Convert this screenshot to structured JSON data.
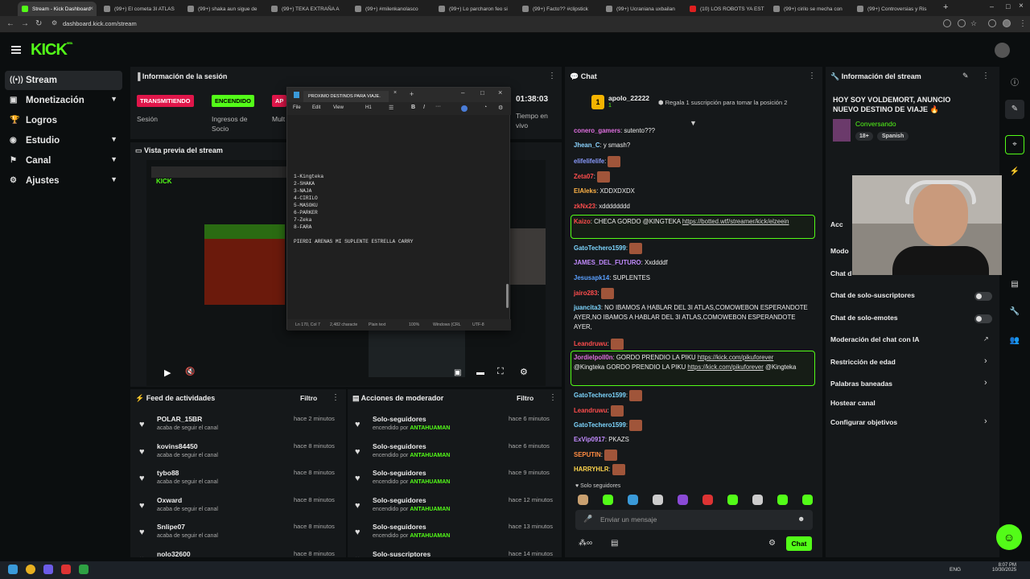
{
  "browser": {
    "tabs": [
      {
        "label": "Stream - Kick Dashboard",
        "active": true
      },
      {
        "label": "(99+) El cometa 3I ATLAS"
      },
      {
        "label": "(99+) shaka aun sigue de"
      },
      {
        "label": "(99+) TEKA EXTRAÑA A"
      },
      {
        "label": "(99+) #milenkanolasco"
      },
      {
        "label": "(99+) Lo parcharon feo si"
      },
      {
        "label": "(99+) Facto?? #clipstick"
      },
      {
        "label": "(99+) Ucraniana uxbailan"
      },
      {
        "label": "(10) LOS ROBOTS YA EST"
      },
      {
        "label": "(99+) cirilo se mecha con"
      },
      {
        "label": "(99+) Controversias y Ris"
      }
    ],
    "url": "dashboard.kick.com/stream"
  },
  "brand": {
    "logo": "KICK",
    "beta": "BETA",
    "accent": "#53fc18"
  },
  "sidebar": {
    "items": [
      {
        "label": "Stream",
        "icon": "broadcast-icon"
      },
      {
        "label": "Monetización",
        "icon": "wallet-icon"
      },
      {
        "label": "Logros",
        "icon": "trophy-icon"
      },
      {
        "label": "Estudio",
        "icon": "studio-icon"
      },
      {
        "label": "Canal",
        "icon": "flag-icon"
      },
      {
        "label": "Ajustes",
        "icon": "gear-icon"
      }
    ]
  },
  "session": {
    "title": "Información de la sesión",
    "badge_live": "TRANSMITIENDO",
    "badge_on": "ENCENDIDO",
    "badge_partial": "AP",
    "label_session": "Sesión",
    "label_income": "Ingresos de Socio",
    "label_multi": "Mult",
    "time": "01:38:03",
    "time_label": "Tiempo en vivo"
  },
  "preview": {
    "title": "Vista previa del stream"
  },
  "editor": {
    "title": "PROXIMO DESTINOS PARA VIAJE.",
    "menu": [
      "File",
      "Edit",
      "View",
      "H1"
    ],
    "lines": "1-Kingteka\n2-SHAKA\n3-NAJA\n4-CIRILO\n5-MASOKU\n6-PARKER\n7-Zeka\n8-FARA\n\nPIERDI ARENAS MI SUPLENTE ESTRELLA CARRY",
    "status": [
      "Ln 170, Col 7",
      "2,482 characte",
      "Plain text",
      "100%",
      "Windows (CRL",
      "UTF-8"
    ]
  },
  "activity": {
    "title": "Feed de actividades",
    "filter": "Filtro",
    "items": [
      {
        "name": "POLAR_15BR",
        "sub": "acaba de seguir el canal",
        "time": "hace 2 minutos"
      },
      {
        "name": "kovins84450",
        "sub": "acaba de seguir el canal",
        "time": "hace 8 minutos"
      },
      {
        "name": "tybo88",
        "sub": "acaba de seguir el canal",
        "time": "hace 8 minutos"
      },
      {
        "name": "Oxward",
        "sub": "acaba de seguir el canal",
        "time": "hace 8 minutos"
      },
      {
        "name": "Snlipe07",
        "sub": "acaba de seguir el canal",
        "time": "hace 8 minutos"
      },
      {
        "name": "nolo32600",
        "sub": "",
        "time": "hace 8 minutos"
      }
    ]
  },
  "moderator": {
    "title": "Acciones de moderador",
    "filter": "Filtro",
    "items": [
      {
        "name": "Solo-seguidores",
        "sub": "encendido por",
        "by": "ANTAHUAMAN",
        "time": "hace 6 minutos"
      },
      {
        "name": "Solo-seguidores",
        "sub": "encendido por",
        "by": "ANTAHUAMAN",
        "time": "hace 6 minutos"
      },
      {
        "name": "Solo-seguidores",
        "sub": "encendido por",
        "by": "ANTAHUAMAN",
        "time": "hace 9 minutos"
      },
      {
        "name": "Solo-seguidores",
        "sub": "encendido por",
        "by": "ANTAHUAMAN",
        "time": "hace 12 minutos"
      },
      {
        "name": "Solo-seguidores",
        "sub": "encendido por",
        "by": "ANTAHUAMAN",
        "time": "hace 13 minutos"
      },
      {
        "name": "Solo-suscriptores",
        "sub": "",
        "by": "",
        "time": "hace 14 minutos"
      }
    ]
  },
  "chat": {
    "title": "Chat",
    "top_gifter": "apolo_22222",
    "gift_count": "1",
    "gift_cta": "Regala 1 suscripción para tomar la posición 2",
    "messages": [
      {
        "user": "conero_gamers",
        "color": "#e06fe0",
        "text": ": sutento???"
      },
      {
        "user": "Jhean_C",
        "color": "#8bd3ff",
        "text": ": y smash?"
      },
      {
        "user": "elifelifelife",
        "color": "#8b9cff",
        "text": ":"
      },
      {
        "user": "Zeta07",
        "color": "#ff4d4d",
        "text": ":"
      },
      {
        "user": "ElAleks",
        "color": "#ffb347",
        "text": ": XDDXDXDX"
      },
      {
        "user": "zkNx23",
        "color": "#ff4d4d",
        "text": ": xdddddddd"
      },
      {
        "user": "Kaizo",
        "color": "#ff4d4d",
        "text": ": CHECA GORDO @KINGTEKA",
        "link": "https://botted.wtf/streamer/kick/elzeein"
      },
      {
        "user": "GatoTechero1599",
        "color": "#7ed6ff",
        "text": ":"
      },
      {
        "user": "JAMES_DEL_FUTURO",
        "color": "#c28bff",
        "text": ": Xxddddf"
      },
      {
        "user": "Jesusapk14",
        "color": "#5aa0ff",
        "text": ": SUPLENTES"
      },
      {
        "user": "jairo283",
        "color": "#ff4d4d",
        "text": ":"
      },
      {
        "user": "juancita3",
        "color": "#7ed6ff",
        "text": ": NO IBAMOS A HABLAR DEL 3I ATLAS,COMOWEBON ESPERANDOTE AYER,NO IBAMOS A HABLAR DEL 3I ATLAS,COMOWEBON ESPERANDOTE AYER,"
      },
      {
        "user": "Leandruwu",
        "color": "#ff4d4d",
        "text": ":"
      },
      {
        "user": "Jordielpoll0n",
        "color": "#e06fe0",
        "text": ": GORDO PRENDIO LA PIKU",
        "link": "https://kick.com/pikuforever",
        "text2": "@Kingteka  GORDO PRENDIO LA PIKU",
        "link2": "https://kick.com/pikuforever",
        "text3": "@Kingteka"
      },
      {
        "user": "GatoTechero1599",
        "color": "#7ed6ff",
        "text": ":"
      },
      {
        "user": "Leandruwu",
        "color": "#ff4d4d",
        "text": ":"
      },
      {
        "user": "GatoTechero1599",
        "color": "#7ed6ff",
        "text": ":"
      },
      {
        "user": "ExVip0917",
        "color": "#c28bff",
        "text": ": PKAZS"
      },
      {
        "user": "SEPUTIN",
        "color": "#ff8c42",
        "text": ":"
      },
      {
        "user": "HARRYHLR",
        "color": "#ffd54d",
        "text": ":"
      }
    ],
    "mode": "Solo seguidores",
    "placeholder": "Enviar un mensaje",
    "send": "Chat"
  },
  "info": {
    "title": "Información del stream",
    "stream_title": "HOY SOY VOLDEMORT, ANUNCIO NUEVO DESTINO DE VIAJE",
    "category": "Conversando",
    "age": "18+",
    "lang": "Spanish",
    "partial_header": "Acc",
    "rows": [
      {
        "label": "Modo",
        "control": "none"
      },
      {
        "label": "Chat d",
        "control": "none"
      },
      {
        "label": "Chat de solo-suscriptores",
        "control": "toggle"
      },
      {
        "label": "Chat de solo-emotes",
        "control": "toggle"
      },
      {
        "label": "Moderación del chat con IA",
        "control": "external"
      },
      {
        "label": "Restricción de edad",
        "control": "chevron"
      },
      {
        "label": "Palabras baneadas",
        "control": "chevron"
      },
      {
        "label": "Hostear canal",
        "control": "none"
      },
      {
        "label": "Configurar objetivos",
        "control": "chevron"
      }
    ]
  },
  "taskbar": {
    "lang": "ENG",
    "time": "8:07 PM",
    "date": "10/30/2025"
  }
}
